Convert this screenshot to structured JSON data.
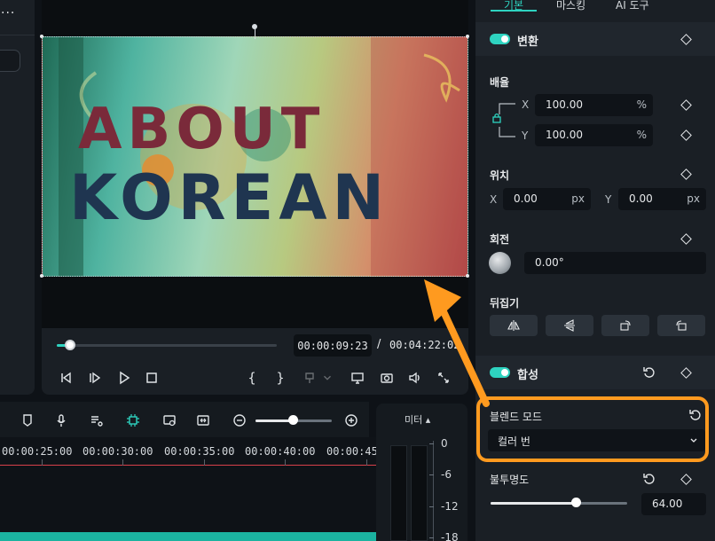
{
  "left_panel": {
    "menu": "···"
  },
  "preview": {
    "current_time": "00:00:09:23",
    "separator": "/",
    "total_time": "00:04:22:02",
    "video_title_top": "ABOUT",
    "video_title_bottom": "KOREAN",
    "playback_progress": 0.06
  },
  "timeline": {
    "ruler_labels": [
      "00:00:25:00",
      "00:00:30:00",
      "00:00:35:00",
      "00:00:40:00",
      "00:00:45:"
    ],
    "zoom_level": 0.5
  },
  "meter": {
    "title": "미터 ▴",
    "scale": [
      "0",
      "-6",
      "-12",
      "-18"
    ]
  },
  "inspector": {
    "tabs": [
      "기본",
      "마스킹",
      "AI 도구"
    ],
    "transform": {
      "title": "변환",
      "scale_label": "배율",
      "scale_x_axis": "X",
      "scale_x": "100.00",
      "scale_x_unit": "%",
      "scale_y_axis": "Y",
      "scale_y": "100.00",
      "scale_y_unit": "%",
      "position_label": "위치",
      "pos_x_axis": "X",
      "pos_x": "0.00",
      "pos_x_unit": "px",
      "pos_y_axis": "Y",
      "pos_y": "0.00",
      "pos_y_unit": "px",
      "rotation_label": "회전",
      "rotation": "0.00°",
      "flip_label": "뒤집기"
    },
    "compositing": {
      "title": "합성",
      "blend_mode_label": "블렌드 모드",
      "blend_mode_value": "컬러 번",
      "opacity_label": "불투명도",
      "opacity_value": "64.00",
      "opacity_fraction": 0.64
    }
  },
  "colors": {
    "accent": "#2ed3c0",
    "highlight": "#ff9a1f",
    "playhead": "#d6404a"
  }
}
